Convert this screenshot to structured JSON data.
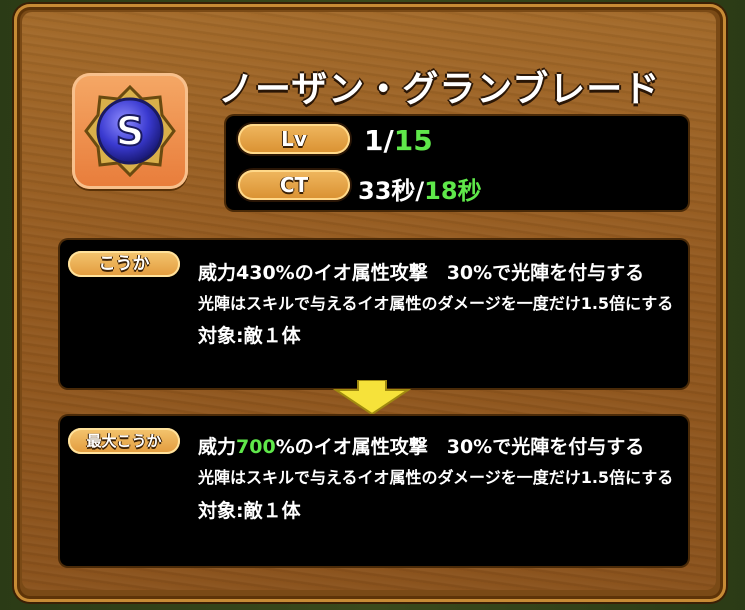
{
  "skill": {
    "title": "ノーザン・グランブレード",
    "icon": "s-rank-orb-icon",
    "icon_letter": "S"
  },
  "stats": {
    "lv_label": "Lv",
    "lv_current": "1/",
    "lv_max": "15",
    "ct_label": "CT",
    "ct_current": "33秒/",
    "ct_min": "18秒"
  },
  "effect": {
    "label": "こうか",
    "line1": "威力430%のイオ属性攻撃　30%で光陣を付与する",
    "line2": "光陣はスキルで与えるイオ属性のダメージを一度だけ1.5倍にする",
    "line3": "対象:敵１体"
  },
  "max_effect": {
    "label": "最大こうか",
    "line1_prefix": "威力",
    "line1_value": "700",
    "line1_suffix": "%のイオ属性攻撃　30%で光陣を付与する",
    "line2": "光陣はスキルで与えるイオ属性のダメージを一度だけ1.5倍にする",
    "line3": "対象:敵１体"
  },
  "colors": {
    "highlight_green": "#5fe84a",
    "arrow_yellow": "#f6e23a"
  }
}
